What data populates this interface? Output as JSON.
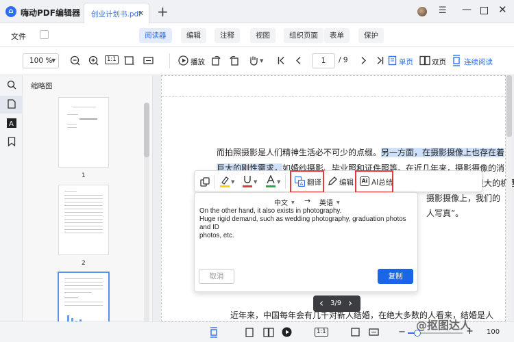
{
  "app": {
    "name": "嗨动PDF编辑器",
    "logo_letter": "⌂"
  },
  "tabs": [
    {
      "label": "创业计划书.pdf",
      "close": "✕"
    }
  ],
  "titlebar": {
    "new_tab": "+",
    "menu": "☰",
    "minimize": "—",
    "close": "✕"
  },
  "menubar": {
    "file": "文件",
    "tabs": [
      "阅读器",
      "编辑",
      "注释",
      "视图",
      "组织页面",
      "表单",
      "保护"
    ],
    "active_tab": "阅读器"
  },
  "toolbar": {
    "zoom": "100 %",
    "play_label": "播放",
    "page_current": "1",
    "page_total": "/ 9",
    "single_label": "单页",
    "double_label": "双页",
    "continuous_label": "连续阅读",
    "fit_label": "1:1"
  },
  "thumbnails": {
    "title": "缩略图",
    "pages": [
      "1",
      "2"
    ]
  },
  "document": {
    "lines": [
      {
        "pre": "而拍照摄影是人们精神生活必不可少的点缀。",
        "hl": "另一方面，在摄影摄像上也存在着"
      },
      {
        "hl": "巨大的刚性需求，",
        "pre2": "如婚纱摄影、毕业照和证件照等。在近几年来，摄影摄像的消"
      },
      {
        "tail": "市场中存在着很大的机遇。"
      },
      {
        "tail": "摄影摄像上，我们的"
      },
      {
        "tail": "人写真”。"
      }
    ],
    "bottom_line": "近年来，中国每年会有几千对新人结婚，在绝大多数的人看来，结婚是人"
  },
  "float_toolbar": {
    "translate_label": "翻译",
    "edit_label": "编辑",
    "ai_label": "AI总结",
    "ai_icon_text": "Ai"
  },
  "translate": {
    "source_lang": "中文",
    "target_lang": "英语",
    "arrow": "→",
    "text_line1": "On the other hand, it also exists in photography.",
    "text_line2": "Huge rigid demand, such as wedding photography, graduation photos and ID",
    "text_line3": "photos, etc.",
    "cancel": "取消",
    "copy": "复制"
  },
  "page_pill": {
    "text": "3/9",
    "prev": "‹",
    "next": "›"
  },
  "status": {
    "zoom": "100",
    "fit_label": "1:1"
  },
  "watermark": "@抠图达人",
  "colors": {
    "accent": "#2e6ff2",
    "highlight": "#cfe0fb",
    "red_box": "#e23a3a"
  }
}
